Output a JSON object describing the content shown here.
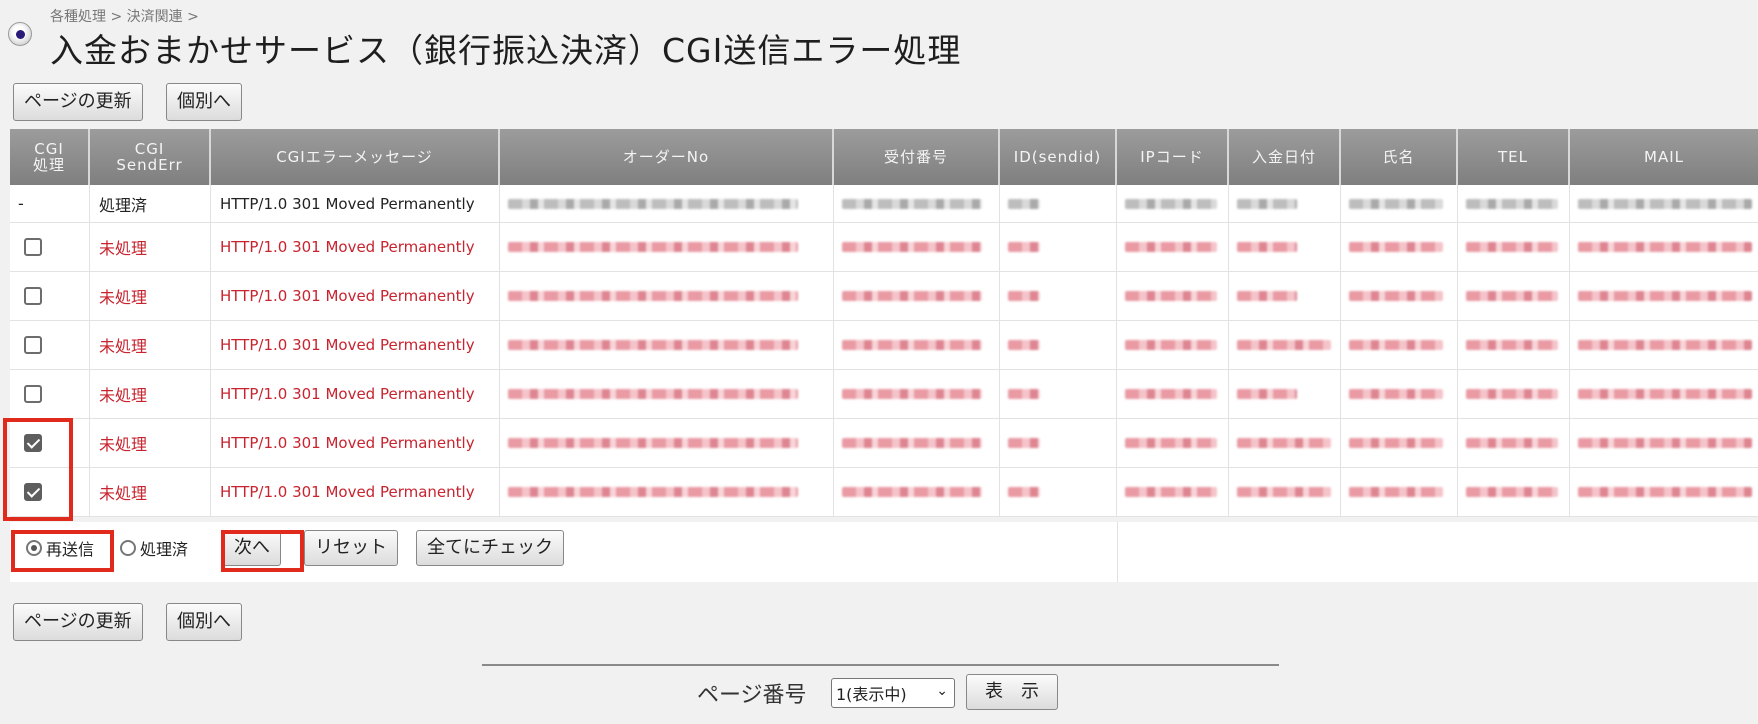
{
  "header": {
    "breadcrumb": "各種処理 > 決済関連 >",
    "title": "入金おまかせサービス（銀行振込決済）CGI送信エラー処理"
  },
  "toolbar_top": {
    "refresh": "ページの更新",
    "individual": "個別へ"
  },
  "toolbar_bottom": {
    "refresh": "ページの更新",
    "individual": "個別へ"
  },
  "table": {
    "columns": [
      "CGI\n処理",
      "CGI\nSendErr",
      "CGIエラーメッセージ",
      "オーダーNo",
      "受付番号",
      "ID(sendid)",
      "IPコード",
      "入金日付",
      "氏名",
      "TEL",
      "MAIL"
    ],
    "rows": [
      {
        "cgi": "-",
        "checked": false,
        "status": "処理済",
        "message": "HTTP/1.0 301 Moved Permanently",
        "error": false
      },
      {
        "cgi": "",
        "checked": false,
        "status": "未処理",
        "message": "HTTP/1.0 301 Moved Permanently",
        "error": true
      },
      {
        "cgi": "",
        "checked": false,
        "status": "未処理",
        "message": "HTTP/1.0 301 Moved Permanently",
        "error": true
      },
      {
        "cgi": "",
        "checked": false,
        "status": "未処理",
        "message": "HTTP/1.0 301 Moved Permanently",
        "error": true
      },
      {
        "cgi": "",
        "checked": false,
        "status": "未処理",
        "message": "HTTP/1.0 301 Moved Permanently",
        "error": true
      },
      {
        "cgi": "",
        "checked": true,
        "status": "未処理",
        "message": "HTTP/1.0 301 Moved Permanently",
        "error": true
      },
      {
        "cgi": "",
        "checked": true,
        "status": "未処理",
        "message": "HTTP/1.0 301 Moved Permanently",
        "error": true
      }
    ]
  },
  "actions": {
    "radio_resend": "再送信",
    "radio_done": "処理済",
    "selected": "resend",
    "next": "次へ",
    "reset": "リセット",
    "check_all": "全てにチェック"
  },
  "pager": {
    "label": "ページ番号",
    "selected_page": "1(表示中)",
    "show": "表　示"
  },
  "colors": {
    "accent_red": "#c8232e",
    "highlight": "#e02a1b",
    "header_gray": "#8f8f8f"
  }
}
